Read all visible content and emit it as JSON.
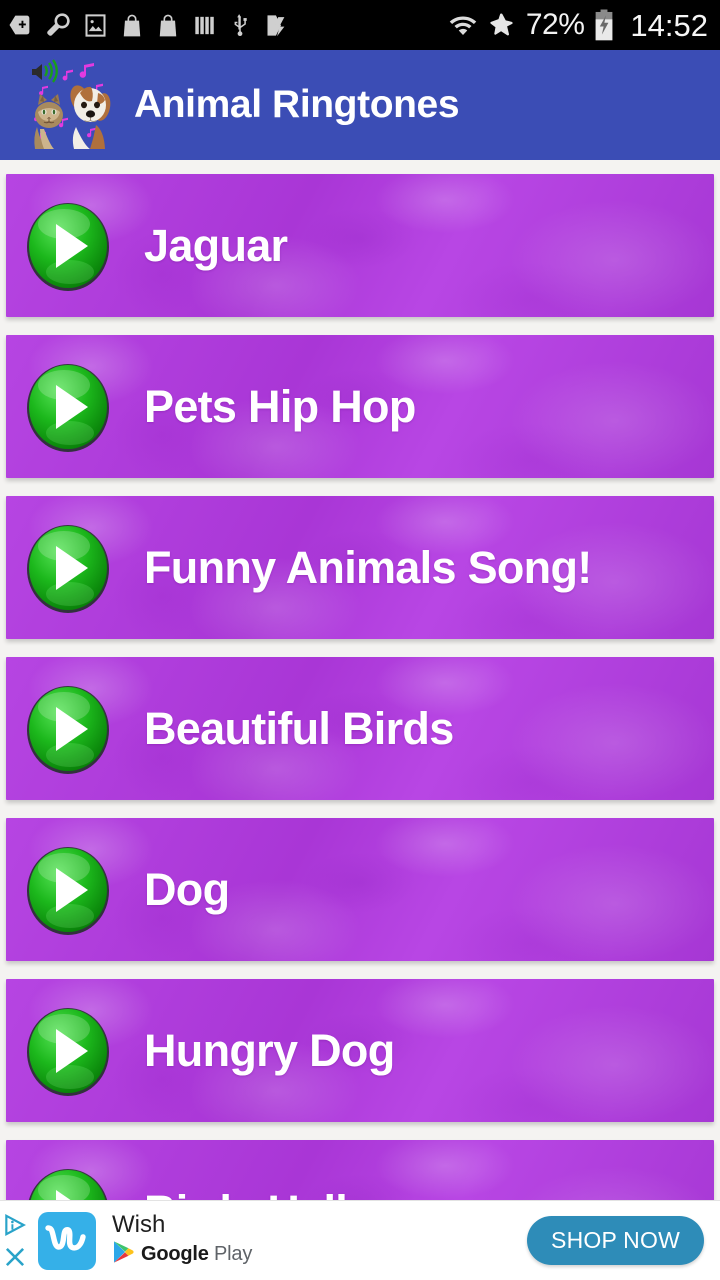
{
  "status_bar": {
    "left_icons": [
      {
        "name": "sd-card-plus-icon"
      },
      {
        "name": "wrench-icon"
      },
      {
        "name": "image-icon"
      },
      {
        "name": "shopping-bag-icon"
      },
      {
        "name": "shopping-bag-icon-2"
      },
      {
        "name": "bars-icon"
      },
      {
        "name": "usb-icon"
      },
      {
        "name": "tasks-check-icon"
      }
    ],
    "right_icons": [
      {
        "name": "wifi-icon"
      },
      {
        "name": "airplane-mode-icon"
      }
    ],
    "battery_percent": "72%",
    "battery_icon": "battery-charging-icon",
    "clock": "14:52"
  },
  "app_bar": {
    "icon_name": "cat-dog-music-app-icon",
    "title": "Animal Ringtones",
    "background_color": "#3b4db5"
  },
  "list": {
    "play_icon_name": "play-icon",
    "card_color": "#b341e0",
    "play_button_color": "#16a81a",
    "items": [
      {
        "label": "Jaguar"
      },
      {
        "label": "Pets Hip Hop"
      },
      {
        "label": "Funny Animals Song!"
      },
      {
        "label": "Beautiful Birds"
      },
      {
        "label": "Dog"
      },
      {
        "label": "Hungry Dog"
      },
      {
        "label": "Birds Hello"
      }
    ]
  },
  "ad": {
    "info_icon_name": "ad-choices-icon",
    "close_icon_name": "close-icon",
    "app_icon_name": "wish-app-icon",
    "advertiser": "Wish",
    "store_icon_name": "google-play-icon",
    "store_name_bold": "Google",
    "store_name_light": " Play",
    "cta_label": "SHOP NOW",
    "cta_color": "#2e8cb8"
  }
}
